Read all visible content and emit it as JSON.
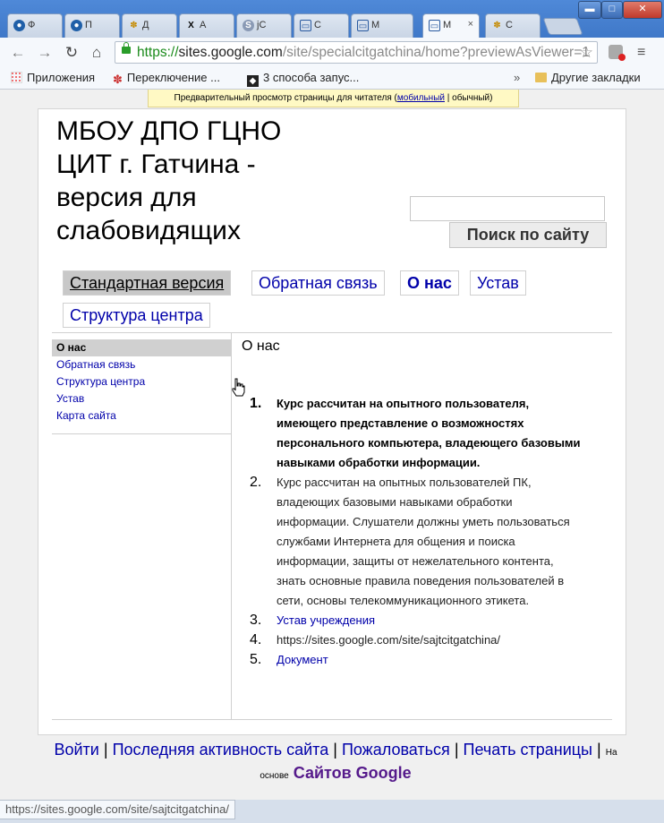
{
  "browser": {
    "tabs": [
      {
        "label": "Ф",
        "icon": "blue-circle-icon"
      },
      {
        "label": "П",
        "icon": "blue-circle-icon"
      },
      {
        "label": "Д",
        "icon": "joomla-icon"
      },
      {
        "label": "А",
        "icon": "x-logo-icon"
      },
      {
        "label": "jC",
        "icon": "s-circle-icon"
      },
      {
        "label": "С",
        "icon": "sites-page-icon"
      },
      {
        "label": "М",
        "icon": "sites-page-icon"
      },
      {
        "label": "М",
        "icon": "sites-page-icon",
        "active": true,
        "close": "×"
      },
      {
        "label": "С",
        "icon": "joomla-icon"
      }
    ],
    "window_buttons": {
      "minimize": "▬",
      "maximize": "□",
      "close": "✕"
    },
    "url": {
      "scheme": "https://",
      "host": "sites.google.com",
      "path": "/site/specialcitgatchina/home?previewAsViewer=1"
    },
    "bookmarks": [
      {
        "label": "Приложения",
        "icon": "apps-grid-icon"
      },
      {
        "label": "Переключение ...",
        "icon": "joomla-icon"
      },
      {
        "label": "3 способа запус...",
        "icon": "diamond-icon"
      }
    ],
    "bookmarks_overflow": "»",
    "other_bookmarks": "Другие закладки",
    "status_url": "https://sites.google.com/site/sajtcitgatchina/"
  },
  "preview_bar": {
    "text": "Предварительный просмотр страницы для читателя (",
    "mobile": "мобильный",
    "sep": " | ",
    "normal": "обычный",
    "end": ")"
  },
  "site": {
    "title": "МБОУ ДПО ГЦНО ЦИТ г. Гатчина - версия для слабовидящих",
    "search_button": "Поиск по сайту",
    "nav": {
      "standard": "Стандартная версия",
      "feedback": "Обратная связь",
      "about": "О нас",
      "charter": "Устав",
      "structure": "Структура центра"
    },
    "sidebar": [
      "О нас",
      "Обратная связь",
      "Структура центра",
      "Устав",
      "Карта сайта"
    ],
    "content_title": "О нас",
    "list": [
      {
        "num": "1.",
        "text": "Курс рассчитан на опытного пользователя, имеющего представление о возможностях персонального компьютера, владеющего базовыми навыками обработки информации."
      },
      {
        "num": "2.",
        "text": "Курс рассчитан на опытных пользователей ПК, владеющих базовыми навыками обработки информации. Слушатели должны  уметь пользоваться службами Интернета для общения и поиска информации, защиты от нежелательного контента, знать основные правила поведения пользователей в сети, основы телекоммуникационного этикета."
      },
      {
        "num": "3.",
        "text": "Устав учреждения"
      },
      {
        "num": "4.",
        "text": "https://sites.google.com/site/sajtcitgatchina/"
      },
      {
        "num": "5.",
        "text": "Документ"
      }
    ]
  },
  "footer": {
    "login": "Войти",
    "activity": "Последняя активность сайта",
    "report": "Пожаловаться",
    "print": "Печать страницы",
    "sep": "|",
    "powered": "На основе",
    "google_sites": "Сайтов Google"
  }
}
